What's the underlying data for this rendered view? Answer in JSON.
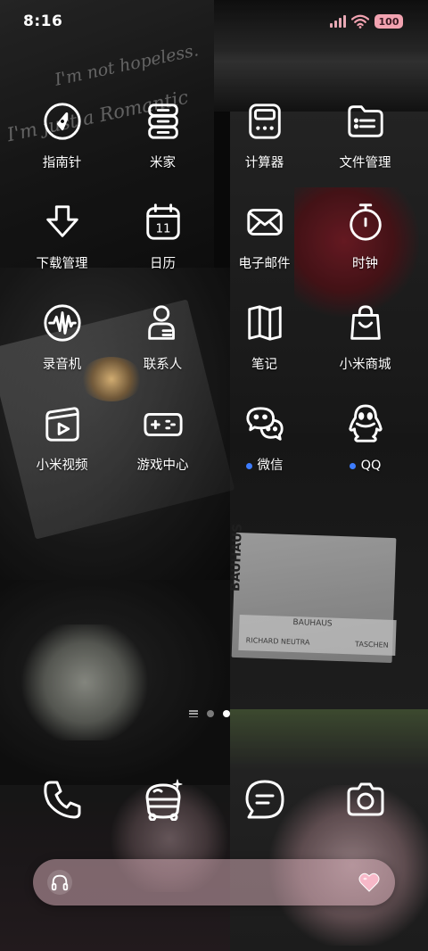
{
  "status_bar": {
    "time": "8:16",
    "battery": "100"
  },
  "apps": [
    {
      "label": "指南针",
      "icon": "compass-icon"
    },
    {
      "label": "米家",
      "icon": "mijia-icon"
    },
    {
      "label": "计算器",
      "icon": "calculator-icon"
    },
    {
      "label": "文件管理",
      "icon": "file-manager-icon"
    },
    {
      "label": "下载管理",
      "icon": "download-icon"
    },
    {
      "label": "日历",
      "icon": "calendar-icon",
      "day": "11"
    },
    {
      "label": "电子邮件",
      "icon": "mail-icon"
    },
    {
      "label": "时钟",
      "icon": "clock-icon"
    },
    {
      "label": "录音机",
      "icon": "recorder-icon"
    },
    {
      "label": "联系人",
      "icon": "contacts-icon"
    },
    {
      "label": "笔记",
      "icon": "notes-icon"
    },
    {
      "label": "小米商城",
      "icon": "mi-store-icon"
    },
    {
      "label": "小米视频",
      "icon": "mi-video-icon"
    },
    {
      "label": "游戏中心",
      "icon": "game-center-icon"
    },
    {
      "label": "微信",
      "icon": "wechat-icon",
      "new_badge": true
    },
    {
      "label": "QQ",
      "icon": "qq-icon",
      "new_badge": true
    }
  ],
  "pager": {
    "pages": 2,
    "current": 2
  },
  "dock": [
    {
      "icon": "phone-icon"
    },
    {
      "icon": "themes-icon"
    },
    {
      "icon": "messages-icon"
    },
    {
      "icon": "camera-icon"
    }
  ],
  "music_widget": {
    "left_icon": "headphones-icon",
    "right_icon": "heart-icon"
  },
  "wallpaper": {
    "texts": [
      "I'm not hopeless.",
      "I'm just a Romantic",
      "BAUHAUS",
      "RICHARD NEUTRA",
      "TASCHEN"
    ]
  },
  "colors": {
    "accent_pink": "#f2a3b1",
    "badge_blue": "#3d7cff"
  }
}
